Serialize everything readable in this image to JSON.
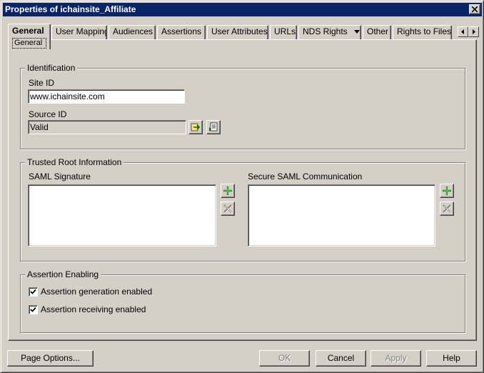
{
  "window": {
    "title": "Properties of ichainsite_Affiliate"
  },
  "tabs": [
    {
      "label": "General",
      "sub": "General",
      "active": true
    },
    {
      "label": "User Mapping"
    },
    {
      "label": "Audiences"
    },
    {
      "label": "Assertions"
    },
    {
      "label": "User Attributes"
    },
    {
      "label": "URLs"
    },
    {
      "label": "NDS Rights"
    },
    {
      "label": "Other"
    },
    {
      "label": "Rights to Files a"
    }
  ],
  "identification": {
    "legend": "Identification",
    "site_id_label": "Site ID",
    "site_id_value": "www.ichainsite.com",
    "source_id_label": "Source ID",
    "source_id_value": "Valid"
  },
  "trusted_root": {
    "legend": "Trusted Root Information",
    "saml_signature_label": "SAML Signature",
    "secure_saml_label": "Secure SAML Communication"
  },
  "assertion_enabling": {
    "legend": "Assertion Enabling",
    "generation_label": "Assertion generation enabled",
    "generation_checked": true,
    "receiving_label": "Assertion receiving enabled",
    "receiving_checked": true
  },
  "buttons": {
    "page_options": "Page Options...",
    "ok": "OK",
    "cancel": "Cancel",
    "apply": "Apply",
    "help": "Help"
  },
  "colors": {
    "titlebar": "#0a246a",
    "face": "#d4d0c8",
    "add_icon": "#1a8a1a"
  }
}
